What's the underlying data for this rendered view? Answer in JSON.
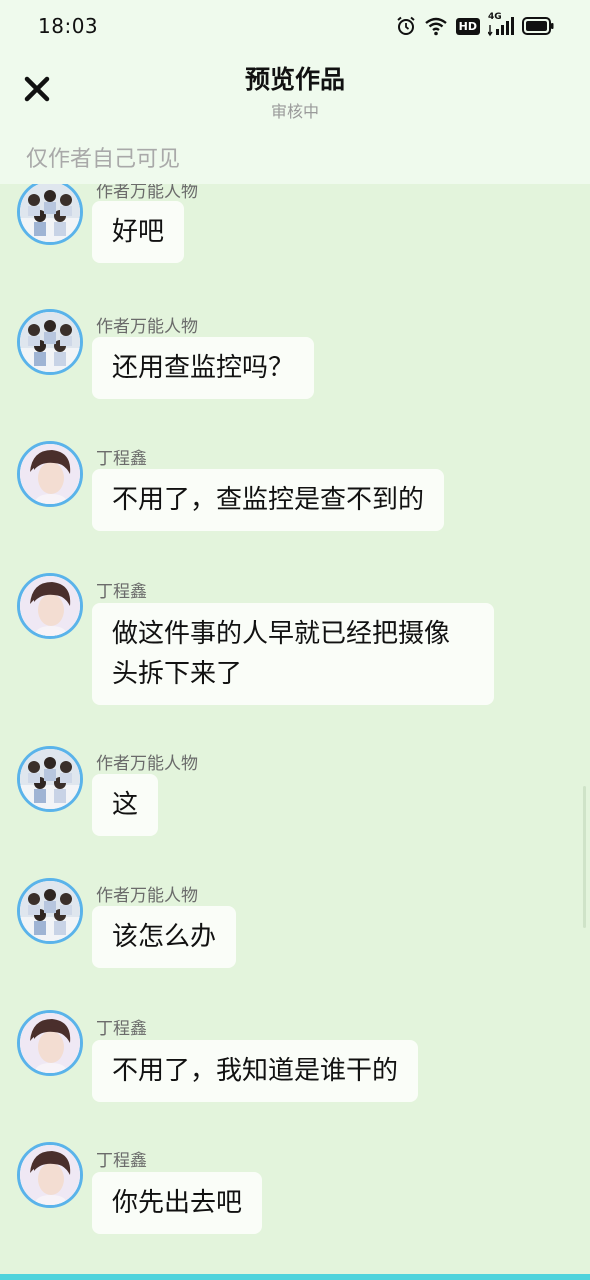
{
  "status_bar": {
    "time": "18:03",
    "hd_label": "HD",
    "network_label": "4G"
  },
  "header": {
    "title": "预览作品",
    "subtitle": "审核中",
    "visibility_note": "仅作者自己可见"
  },
  "messages": [
    {
      "name": "作者万能人物",
      "text": "好吧",
      "avatar": "group-avatar"
    },
    {
      "name": "作者万能人物",
      "text": "还用查监控吗？",
      "avatar": "group-avatar"
    },
    {
      "name": "丁程鑫",
      "text": "不用了，查监控是查不到的",
      "avatar": "portrait-avatar"
    },
    {
      "name": "丁程鑫",
      "text": "做这件事的人早就已经把摄像头拆下来了",
      "avatar": "portrait-avatar"
    },
    {
      "name": "作者万能人物",
      "text": "这",
      "avatar": "group-avatar"
    },
    {
      "name": "作者万能人物",
      "text": "该怎么办",
      "avatar": "group-avatar"
    },
    {
      "name": "丁程鑫",
      "text": "不用了，我知道是谁干的",
      "avatar": "portrait-avatar"
    },
    {
      "name": "丁程鑫",
      "text": "你先出去吧",
      "avatar": "portrait-avatar"
    }
  ],
  "colors": {
    "background": "#e3f4dc",
    "header_background": "#effaed",
    "bubble": "#fafdf8",
    "avatar_border": "#5ab3ea",
    "bottom_strip": "#4fd3dc"
  }
}
